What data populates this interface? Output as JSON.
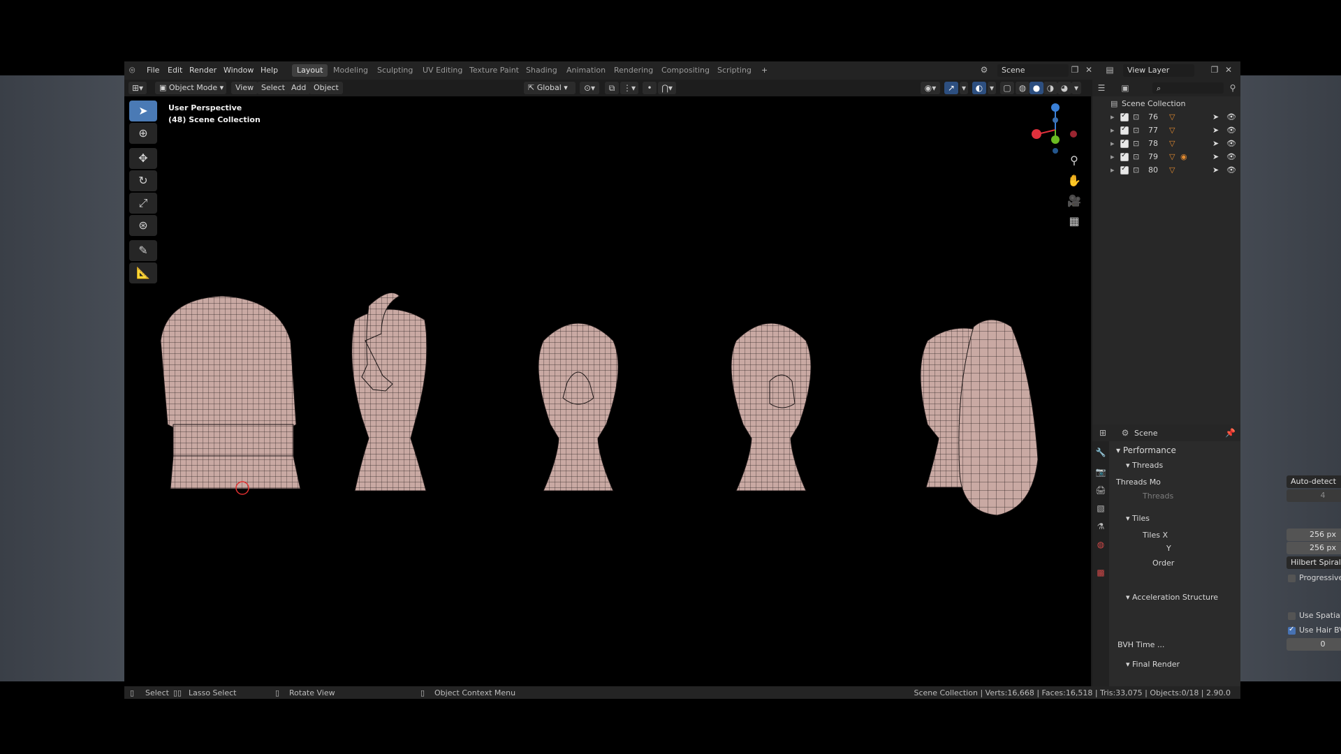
{
  "menu": [
    "File",
    "Edit",
    "Render",
    "Window",
    "Help"
  ],
  "workspaces": [
    "Layout",
    "Modeling",
    "Sculpting",
    "UV Editing",
    "Texture Paint",
    "Shading",
    "Animation",
    "Rendering",
    "Compositing",
    "Scripting"
  ],
  "add_tab": "+",
  "scene": {
    "label": "Scene"
  },
  "view_layer": {
    "label": "View Layer"
  },
  "viewport_header": {
    "mode": "Object Mode",
    "view": "View",
    "select": "Select",
    "add": "Add",
    "object": "Object",
    "transform": "Global"
  },
  "viewport": {
    "line1": "User Perspective",
    "line2": "(48) Scene Collection"
  },
  "outliner": {
    "root": "Scene Collection",
    "items": [
      {
        "name": "76"
      },
      {
        "name": "77"
      },
      {
        "name": "78"
      },
      {
        "name": "79"
      },
      {
        "name": "80"
      }
    ]
  },
  "properties": {
    "context": "Scene",
    "performance": "Performance",
    "threads_header": "Threads",
    "threads_mode_label": "Threads Mo",
    "threads_mode_value": "Auto-detect",
    "threads_label": "Threads",
    "threads_value": "4",
    "tiles_header": "Tiles",
    "tiles_x_label": "Tiles X",
    "tiles_x_value": "256 px",
    "tiles_y_label": "Y",
    "tiles_y_value": "256 px",
    "order_label": "Order",
    "order_value": "Hilbert Spiral",
    "progressive": "Progressive Refi...",
    "accel_header": "Acceleration Structure",
    "spatial": "Use Spatial Splits",
    "hair_bvh": "Use Hair BVH",
    "bvh_label": "BVH Time ...",
    "bvh_value": "0",
    "final_render": "Final Render"
  },
  "status": {
    "select": "Select",
    "lasso": "Lasso Select",
    "rotate": "Rotate View",
    "context_menu": "Object Context Menu",
    "stats": "Scene Collection | Verts:16,668 | Faces:16,518 | Tris:33,075 | Objects:0/18 | 2.90.0"
  },
  "colors": {
    "accent": "#4772b3",
    "mesh": "#c9a9a3",
    "x_axis": "#e0303c",
    "y_axis": "#6bbb22",
    "z_axis": "#3a80d8"
  },
  "icons": [
    "blender-logo",
    "cursor-icon",
    "move-icon",
    "rotate-icon",
    "scale-icon",
    "transform-icon",
    "annotate-icon",
    "measure-icon",
    "zoom-icon",
    "hand-icon",
    "camera-icon",
    "grid-icon"
  ]
}
